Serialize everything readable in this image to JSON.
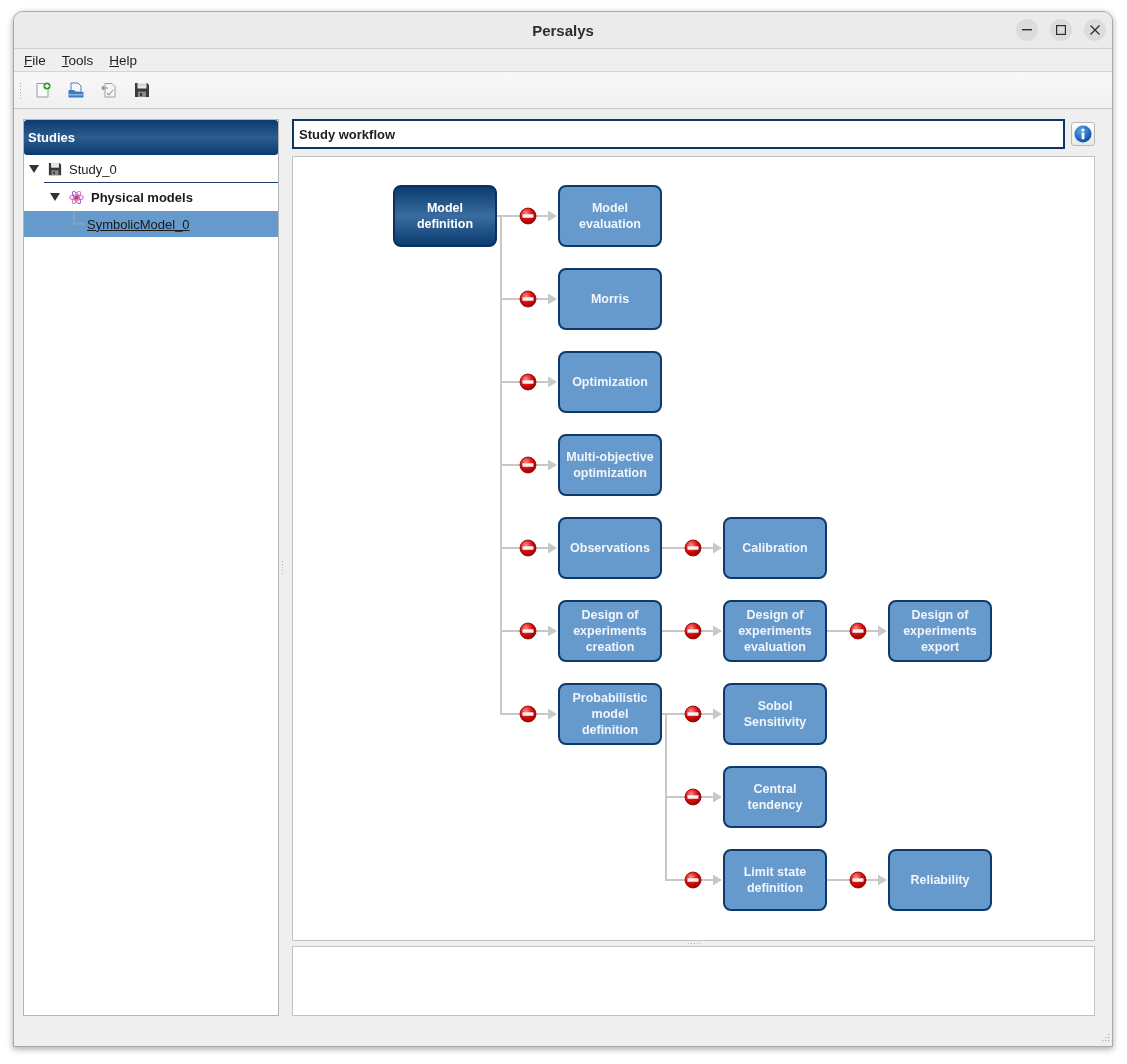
{
  "window": {
    "title": "Persalys"
  },
  "menu": [
    "File",
    "Tools",
    "Help"
  ],
  "sidebar": {
    "title": "Studies",
    "tree": [
      {
        "label": "Study_0",
        "kind": "study",
        "expanded": true,
        "selected": false,
        "children": [
          {
            "label": "Physical models",
            "kind": "category",
            "expanded": true,
            "selected": false,
            "children": [
              {
                "label": "SymbolicModel_0",
                "kind": "model",
                "selected": true
              }
            ]
          }
        ]
      }
    ]
  },
  "workflow": {
    "title": "Study workflow",
    "root": {
      "label": "Model definition",
      "active": true,
      "children": [
        {
          "label": "Model evaluation",
          "active": false,
          "blocked": true
        },
        {
          "label": "Morris",
          "active": false,
          "blocked": true
        },
        {
          "label": "Optimization",
          "active": false,
          "blocked": true
        },
        {
          "label": "Multi-objective optimization",
          "active": false,
          "blocked": true
        },
        {
          "label": "Observations",
          "active": false,
          "blocked": true,
          "children": [
            {
              "label": "Calibration",
              "active": false,
              "blocked": true
            }
          ]
        },
        {
          "label": "Design of experiments creation",
          "active": false,
          "blocked": true,
          "children": [
            {
              "label": "Design of experiments evaluation",
              "active": false,
              "blocked": true,
              "children": [
                {
                  "label": "Design of experiments export",
                  "active": false,
                  "blocked": true
                }
              ]
            }
          ]
        },
        {
          "label": "Probabilistic model definition",
          "active": false,
          "blocked": true,
          "children": [
            {
              "label": "Sobol Sensitivity",
              "active": false,
              "blocked": true
            },
            {
              "label": "Central tendency",
              "active": false,
              "blocked": true
            },
            {
              "label": "Limit state definition",
              "active": false,
              "blocked": true,
              "children": [
                {
                  "label": "Reliability",
                  "active": false,
                  "blocked": true
                }
              ]
            }
          ]
        }
      ]
    }
  }
}
